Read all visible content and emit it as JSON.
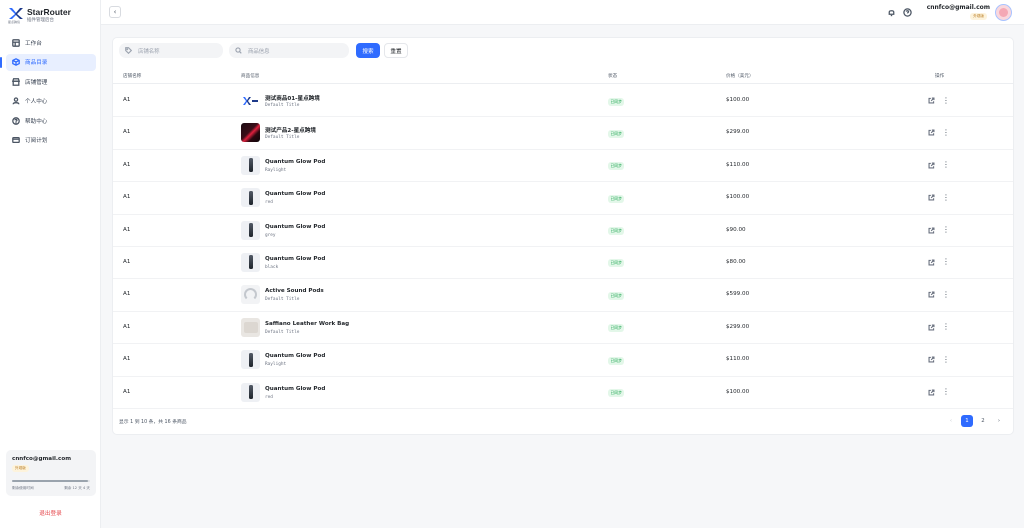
{
  "brand": {
    "name": "StarRouter",
    "subtitle": "插件管理后台",
    "logo_caption": "星点跨境"
  },
  "sidebar": {
    "items": [
      {
        "label": "工作台",
        "icon": "dashboard-icon"
      },
      {
        "label": "商品目录",
        "icon": "box-icon",
        "active": true
      },
      {
        "label": "店铺管理",
        "icon": "store-icon"
      },
      {
        "label": "个人中心",
        "icon": "user-icon"
      },
      {
        "label": "帮助中心",
        "icon": "help-icon"
      },
      {
        "label": "订阅计划",
        "icon": "card-icon"
      }
    ],
    "user": {
      "email": "cnnfco@gmail.com",
      "badge": "外观版",
      "usage_fraction": 0.97,
      "usage_label": "剩余使用时间",
      "remaining": "剩余 12 天 4 天"
    },
    "logout": "退出登录"
  },
  "topbar": {
    "email": "cnnfco@gmail.com",
    "badge": "外观版"
  },
  "filters": {
    "store_placeholder": "店铺名称",
    "product_placeholder": "商品信息",
    "search": "搜索",
    "reset": "重置"
  },
  "table": {
    "headers": {
      "store": "店铺名称",
      "product": "商品信息",
      "status": "状态",
      "price": "价格（美元）",
      "actions": "操作"
    },
    "rows": [
      {
        "store": "A1",
        "name": "测试商品01-星点跨境",
        "variant": "Default Title",
        "status": "已同步",
        "price": "$100.00",
        "thumb": "logo"
      },
      {
        "store": "A1",
        "name": "测试产品2-星点跨境",
        "variant": "Default Title",
        "status": "已同步",
        "price": "$299.00",
        "thumb": "dark"
      },
      {
        "store": "A1",
        "name": "Quantum Glow Pod",
        "variant": "Raylight",
        "status": "已同步",
        "price": "$110.00",
        "thumb": "bottle"
      },
      {
        "store": "A1",
        "name": "Quantum Glow Pod",
        "variant": "red",
        "status": "已同步",
        "price": "$100.00",
        "thumb": "bottle"
      },
      {
        "store": "A1",
        "name": "Quantum Glow Pod",
        "variant": "grey",
        "status": "已同步",
        "price": "$90.00",
        "thumb": "bottle"
      },
      {
        "store": "A1",
        "name": "Quantum Glow Pod",
        "variant": "black",
        "status": "已同步",
        "price": "$80.00",
        "thumb": "bottle"
      },
      {
        "store": "A1",
        "name": "Active Sound Pods",
        "variant": "Default Title",
        "status": "已同步",
        "price": "$599.00",
        "thumb": "phones"
      },
      {
        "store": "A1",
        "name": "Saffiano Leather Work Bag",
        "variant": "Default Title",
        "status": "已同步",
        "price": "$299.00",
        "thumb": "bag"
      },
      {
        "store": "A1",
        "name": "Quantum Glow Pod",
        "variant": "Raylight",
        "status": "已同步",
        "price": "$110.00",
        "thumb": "bottle"
      },
      {
        "store": "A1",
        "name": "Quantum Glow Pod",
        "variant": "red",
        "status": "已同步",
        "price": "$100.00",
        "thumb": "bottle"
      }
    ],
    "summary": "显示 1 到 10 条，共 16 条商品"
  },
  "pagination": {
    "prev": "‹",
    "pages": [
      "1",
      "2"
    ],
    "current": "1",
    "next": "›"
  },
  "colors": {
    "accent": "#2f6bff",
    "success": "#16a34a",
    "danger": "#e5484d"
  }
}
